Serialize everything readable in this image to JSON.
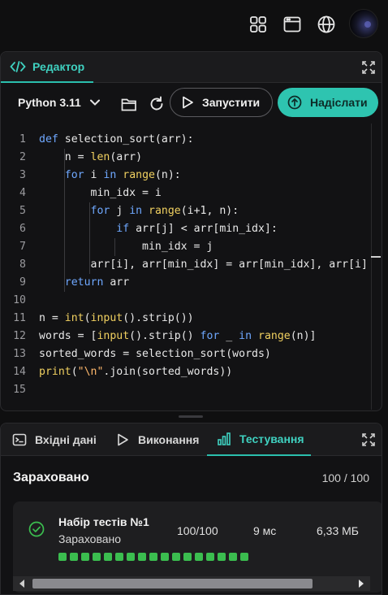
{
  "editor": {
    "tab_label": "Редактор",
    "language": "Python 3.11",
    "run_label": "Запустити",
    "submit_label": "Надіслати",
    "code_lines": [
      {
        "n": "1",
        "html": "<span class=\"kw\">def</span> selection_sort(arr):"
      },
      {
        "n": "2",
        "html": "    n = <span class=\"fn\">len</span>(arr)"
      },
      {
        "n": "3",
        "html": "    <span class=\"kw\">for</span> i <span class=\"kw\">in</span> <span class=\"fn\">range</span>(n):"
      },
      {
        "n": "4",
        "html": "        min_idx = i"
      },
      {
        "n": "5",
        "html": "        <span class=\"kw\">for</span> j <span class=\"kw\">in</span> <span class=\"fn\">range</span>(i+1, n):"
      },
      {
        "n": "6",
        "html": "            <span class=\"kw\">if</span> arr[j] &lt; arr[min_idx]:"
      },
      {
        "n": "7",
        "html": "                min_idx = j"
      },
      {
        "n": "8",
        "html": "        arr[i], arr[min_idx] = arr[min_idx], arr[i]"
      },
      {
        "n": "9",
        "html": "    <span class=\"kw\">return</span> arr"
      },
      {
        "n": "10",
        "html": ""
      },
      {
        "n": "11",
        "html": "n = <span class=\"fn\">int</span>(<span class=\"fn\">input</span>().strip())"
      },
      {
        "n": "12",
        "html": "words = [<span class=\"fn\">input</span>().strip() <span class=\"kw\">for</span> _ <span class=\"kw\">in</span> <span class=\"fn\">range</span>(n)]"
      },
      {
        "n": "13",
        "html": "sorted_words = selection_sort(words)"
      },
      {
        "n": "14",
        "html": "<span class=\"fn\">print</span>(<span class=\"str\">\"\\n\"</span>.join(sorted_words))"
      },
      {
        "n": "15",
        "html": ""
      }
    ]
  },
  "bottom": {
    "tabs": [
      "Вхідні дані",
      "Виконання",
      "Тестування"
    ],
    "active_tab": "Тестування",
    "status_title": "Зараховано",
    "status_score": "100 / 100",
    "suite": {
      "name": "Набір тестів №1",
      "status": "Зараховано",
      "score": "100/100",
      "time": "9 мс",
      "memory": "6,33 МБ",
      "passed_tests": 17
    }
  },
  "colors": {
    "accent": "#2ec4b0",
    "pass": "#3bbd4f",
    "keyword": "#6fa8ff",
    "builtin": "#f0d060"
  },
  "icons": [
    "grid-icon",
    "window-icon",
    "globe-icon",
    "code-icon",
    "expand-icon",
    "chevron-down-icon",
    "folder-icon",
    "refresh-icon",
    "play-icon",
    "upload-icon",
    "terminal-icon",
    "bar-chart-icon",
    "check-circle-icon"
  ]
}
